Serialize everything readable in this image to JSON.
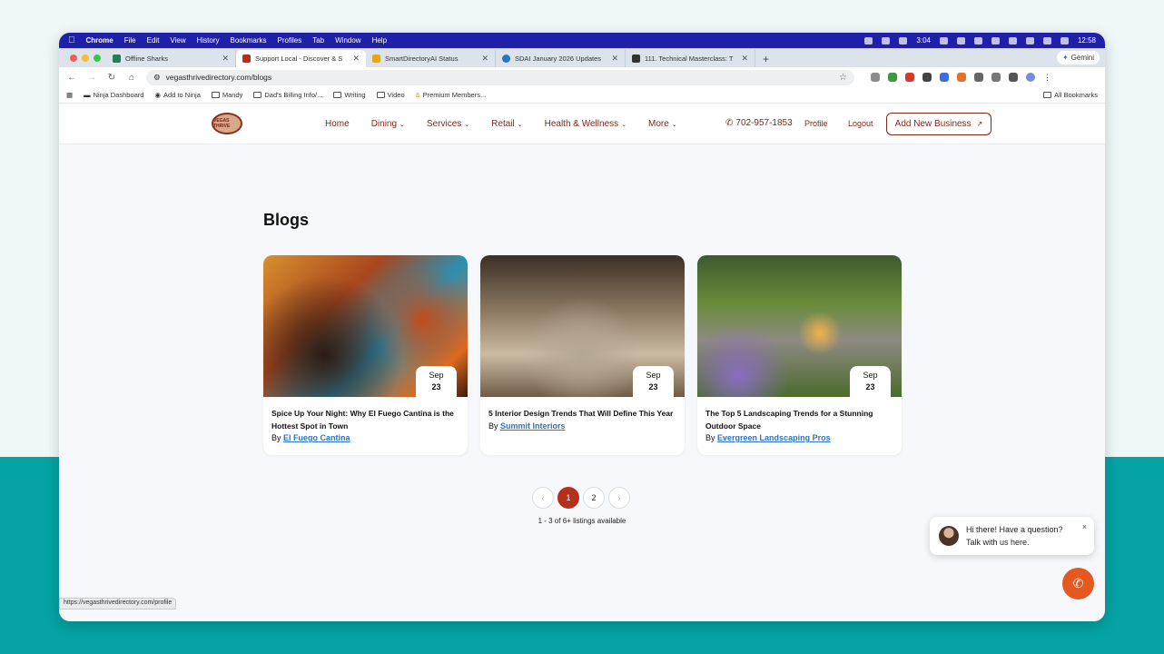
{
  "menubar": {
    "app": "Chrome",
    "items": [
      "File",
      "Edit",
      "View",
      "History",
      "Bookmarks",
      "Profiles",
      "Tab",
      "Window",
      "Help"
    ],
    "battery_time": "3:04",
    "clock": "12:58"
  },
  "tabs": [
    {
      "title": "Offline Sharks",
      "active": false,
      "color": "#2a7a5a"
    },
    {
      "title": "Support Local - Discover & S",
      "active": true,
      "color": "#b3301c"
    },
    {
      "title": "SmartDirectoryAI Status",
      "active": false,
      "color": "#e0a820"
    },
    {
      "title": "SDAI January 2026 Updates",
      "active": false,
      "color": "#2a73c8"
    },
    {
      "title": "111. Technical Masterclass: T",
      "active": false,
      "color": "#333333"
    }
  ],
  "gemini_label": "Gemini",
  "address": {
    "url": "vegasthrivedirectory.com/blogs"
  },
  "bookmarks": {
    "items": [
      "Ninja Dashboard",
      "Add to Ninja",
      "Mandy",
      "Dad's Billing Info/...",
      "Writing",
      "Video",
      "Premium Members..."
    ],
    "all_label": "All Bookmarks"
  },
  "site": {
    "logo_text": "VEGAS THRIVE",
    "nav": [
      {
        "label": "Home",
        "has_menu": false
      },
      {
        "label": "Dining",
        "has_menu": true
      },
      {
        "label": "Services",
        "has_menu": true
      },
      {
        "label": "Retail",
        "has_menu": true
      },
      {
        "label": "Health & Wellness",
        "has_menu": true
      },
      {
        "label": "More",
        "has_menu": true
      }
    ],
    "phone": "702-957-1853",
    "profile_label": "Profile",
    "logout_label": "Logout",
    "add_business_label": "Add New Business"
  },
  "page_title": "Blogs",
  "posts": [
    {
      "month": "Sep",
      "day": "23",
      "title": "Spice Up Your Night: Why El Fuego Cantina is the Hottest Spot in Town",
      "by_label": "By",
      "author": "El Fuego Cantina"
    },
    {
      "month": "Sep",
      "day": "23",
      "title": "5 Interior Design Trends That Will Define This Year",
      "by_label": "By",
      "author": "Summit Interiors"
    },
    {
      "month": "Sep",
      "day": "23",
      "title": "The Top 5 Landscaping Trends for a Stunning Outdoor Space",
      "by_label": "By",
      "author": "Evergreen Landscaping Pros"
    }
  ],
  "pagination": {
    "prev": "‹",
    "pages": [
      "1",
      "2"
    ],
    "current": "1",
    "next": "›"
  },
  "listing_count": "1 - 3 of 6+ listings available",
  "chat": {
    "line1": "Hi there! Have a question?",
    "line2": "Talk with us here.",
    "close": "×"
  },
  "status_url": "https://vegasthrivedirectory.com/profile",
  "colors": {
    "brand": "#7a2b1c",
    "accent": "#b3301c",
    "call": "#e5581f",
    "link": "#2a73c8",
    "teal": "#05a3a4"
  }
}
